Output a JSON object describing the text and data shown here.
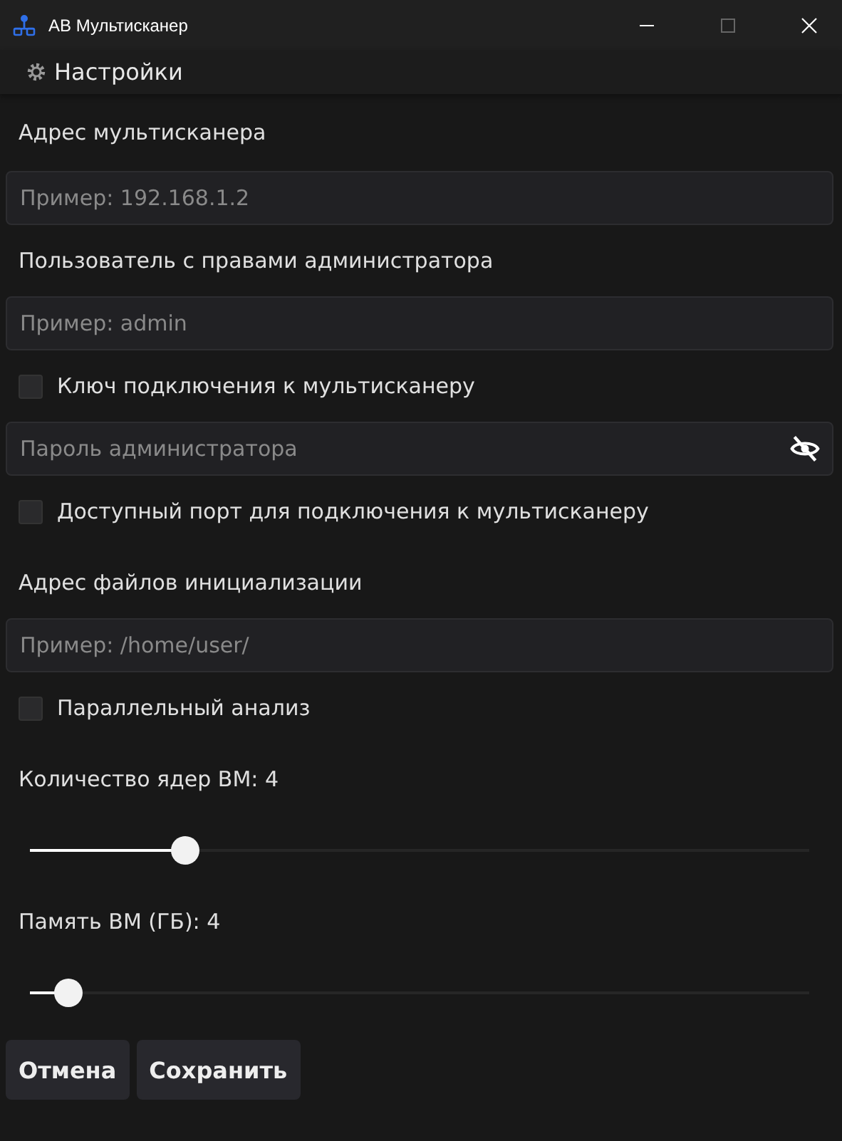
{
  "window": {
    "title": "АВ Мультисканер"
  },
  "menu": {
    "label": "Настройки"
  },
  "items": [
    {
      "kind": "label",
      "text": "Адрес мультисканера"
    },
    {
      "kind": "field",
      "placeholder": "Пример: 192.168.1.2"
    },
    {
      "kind": "label",
      "text": "Пользователь с правами администратора"
    },
    {
      "kind": "field",
      "placeholder": "Пример: admin"
    },
    {
      "kind": "checkbox",
      "text": "Ключ подключения к мультисканеру",
      "checked": false
    },
    {
      "kind": "password",
      "placeholder": "Пароль администратора"
    },
    {
      "kind": "checkbox",
      "text": "Доступный порт для подключения к мультисканеру",
      "checked": false
    },
    {
      "kind": "label",
      "text": "Адрес файлов инициализации"
    },
    {
      "kind": "field",
      "placeholder": "Пример: /home/user/"
    },
    {
      "kind": "checkbox",
      "text": "Параллельный анализ",
      "checked": false
    },
    {
      "kind": "label",
      "text": "Количество ядер ВМ: 4"
    },
    {
      "kind": "slider",
      "level": 0.2
    },
    {
      "kind": "label",
      "text": "Память ВМ (ГБ): 4"
    },
    {
      "kind": "slider",
      "level": 0.05
    }
  ],
  "buttons": [
    "Отмена",
    "Сохранить"
  ]
}
